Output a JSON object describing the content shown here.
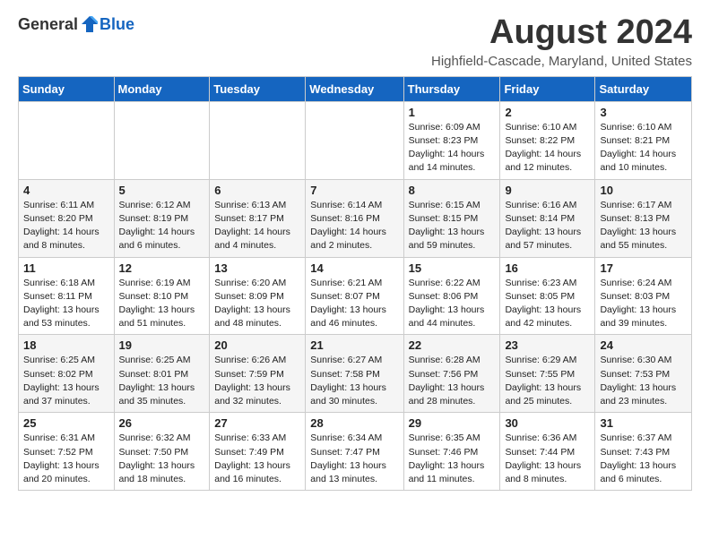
{
  "logo": {
    "general": "General",
    "blue": "Blue"
  },
  "title": "August 2024",
  "subtitle": "Highfield-Cascade, Maryland, United States",
  "headers": [
    "Sunday",
    "Monday",
    "Tuesday",
    "Wednesday",
    "Thursday",
    "Friday",
    "Saturday"
  ],
  "weeks": [
    [
      {
        "day": "",
        "detail": ""
      },
      {
        "day": "",
        "detail": ""
      },
      {
        "day": "",
        "detail": ""
      },
      {
        "day": "",
        "detail": ""
      },
      {
        "day": "1",
        "detail": "Sunrise: 6:09 AM\nSunset: 8:23 PM\nDaylight: 14 hours\nand 14 minutes."
      },
      {
        "day": "2",
        "detail": "Sunrise: 6:10 AM\nSunset: 8:22 PM\nDaylight: 14 hours\nand 12 minutes."
      },
      {
        "day": "3",
        "detail": "Sunrise: 6:10 AM\nSunset: 8:21 PM\nDaylight: 14 hours\nand 10 minutes."
      }
    ],
    [
      {
        "day": "4",
        "detail": "Sunrise: 6:11 AM\nSunset: 8:20 PM\nDaylight: 14 hours\nand 8 minutes."
      },
      {
        "day": "5",
        "detail": "Sunrise: 6:12 AM\nSunset: 8:19 PM\nDaylight: 14 hours\nand 6 minutes."
      },
      {
        "day": "6",
        "detail": "Sunrise: 6:13 AM\nSunset: 8:17 PM\nDaylight: 14 hours\nand 4 minutes."
      },
      {
        "day": "7",
        "detail": "Sunrise: 6:14 AM\nSunset: 8:16 PM\nDaylight: 14 hours\nand 2 minutes."
      },
      {
        "day": "8",
        "detail": "Sunrise: 6:15 AM\nSunset: 8:15 PM\nDaylight: 13 hours\nand 59 minutes."
      },
      {
        "day": "9",
        "detail": "Sunrise: 6:16 AM\nSunset: 8:14 PM\nDaylight: 13 hours\nand 57 minutes."
      },
      {
        "day": "10",
        "detail": "Sunrise: 6:17 AM\nSunset: 8:13 PM\nDaylight: 13 hours\nand 55 minutes."
      }
    ],
    [
      {
        "day": "11",
        "detail": "Sunrise: 6:18 AM\nSunset: 8:11 PM\nDaylight: 13 hours\nand 53 minutes."
      },
      {
        "day": "12",
        "detail": "Sunrise: 6:19 AM\nSunset: 8:10 PM\nDaylight: 13 hours\nand 51 minutes."
      },
      {
        "day": "13",
        "detail": "Sunrise: 6:20 AM\nSunset: 8:09 PM\nDaylight: 13 hours\nand 48 minutes."
      },
      {
        "day": "14",
        "detail": "Sunrise: 6:21 AM\nSunset: 8:07 PM\nDaylight: 13 hours\nand 46 minutes."
      },
      {
        "day": "15",
        "detail": "Sunrise: 6:22 AM\nSunset: 8:06 PM\nDaylight: 13 hours\nand 44 minutes."
      },
      {
        "day": "16",
        "detail": "Sunrise: 6:23 AM\nSunset: 8:05 PM\nDaylight: 13 hours\nand 42 minutes."
      },
      {
        "day": "17",
        "detail": "Sunrise: 6:24 AM\nSunset: 8:03 PM\nDaylight: 13 hours\nand 39 minutes."
      }
    ],
    [
      {
        "day": "18",
        "detail": "Sunrise: 6:25 AM\nSunset: 8:02 PM\nDaylight: 13 hours\nand 37 minutes."
      },
      {
        "day": "19",
        "detail": "Sunrise: 6:25 AM\nSunset: 8:01 PM\nDaylight: 13 hours\nand 35 minutes."
      },
      {
        "day": "20",
        "detail": "Sunrise: 6:26 AM\nSunset: 7:59 PM\nDaylight: 13 hours\nand 32 minutes."
      },
      {
        "day": "21",
        "detail": "Sunrise: 6:27 AM\nSunset: 7:58 PM\nDaylight: 13 hours\nand 30 minutes."
      },
      {
        "day": "22",
        "detail": "Sunrise: 6:28 AM\nSunset: 7:56 PM\nDaylight: 13 hours\nand 28 minutes."
      },
      {
        "day": "23",
        "detail": "Sunrise: 6:29 AM\nSunset: 7:55 PM\nDaylight: 13 hours\nand 25 minutes."
      },
      {
        "day": "24",
        "detail": "Sunrise: 6:30 AM\nSunset: 7:53 PM\nDaylight: 13 hours\nand 23 minutes."
      }
    ],
    [
      {
        "day": "25",
        "detail": "Sunrise: 6:31 AM\nSunset: 7:52 PM\nDaylight: 13 hours\nand 20 minutes."
      },
      {
        "day": "26",
        "detail": "Sunrise: 6:32 AM\nSunset: 7:50 PM\nDaylight: 13 hours\nand 18 minutes."
      },
      {
        "day": "27",
        "detail": "Sunrise: 6:33 AM\nSunset: 7:49 PM\nDaylight: 13 hours\nand 16 minutes."
      },
      {
        "day": "28",
        "detail": "Sunrise: 6:34 AM\nSunset: 7:47 PM\nDaylight: 13 hours\nand 13 minutes."
      },
      {
        "day": "29",
        "detail": "Sunrise: 6:35 AM\nSunset: 7:46 PM\nDaylight: 13 hours\nand 11 minutes."
      },
      {
        "day": "30",
        "detail": "Sunrise: 6:36 AM\nSunset: 7:44 PM\nDaylight: 13 hours\nand 8 minutes."
      },
      {
        "day": "31",
        "detail": "Sunrise: 6:37 AM\nSunset: 7:43 PM\nDaylight: 13 hours\nand 6 minutes."
      }
    ]
  ]
}
